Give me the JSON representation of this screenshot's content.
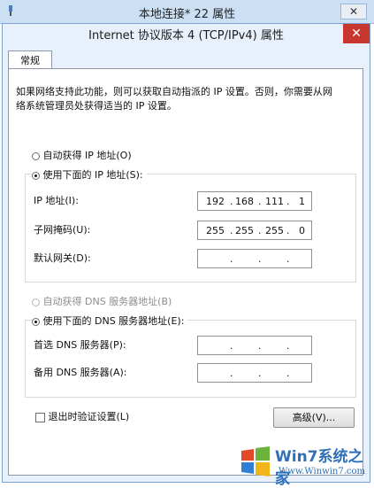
{
  "background_window": {
    "title": "本地连接* 22 属性",
    "close": "✕"
  },
  "dialog": {
    "title": "Internet 协议版本 4 (TCP/IPv4) 属性",
    "close": "✕",
    "tab": "常规",
    "description": [
      "如果网络支持此功能，则可以获取自动指派的 IP 设置。否则，你需要从网",
      "络系统管理员处获得适当的 IP 设置。"
    ],
    "ip": {
      "auto_label": "自动获得 IP 地址(O)",
      "manual_label": "使用下面的 IP 地址(S):",
      "selected": "manual",
      "fields": [
        {
          "label": "IP 地址(I):",
          "octets": [
            "192",
            "168",
            "111",
            "1"
          ]
        },
        {
          "label": "子网掩码(U):",
          "octets": [
            "255",
            "255",
            "255",
            "0"
          ]
        },
        {
          "label": "默认网关(D):",
          "octets": [
            "",
            "",
            "",
            ""
          ]
        }
      ]
    },
    "dns": {
      "auto_label": "自动获得 DNS 服务器地址(B)",
      "manual_label": "使用下面的 DNS 服务器地址(E):",
      "selected": "manual",
      "fields": [
        {
          "label": "首选 DNS 服务器(P):",
          "octets": [
            "",
            "",
            "",
            ""
          ]
        },
        {
          "label": "备用 DNS 服务器(A):",
          "octets": [
            "",
            "",
            "",
            ""
          ]
        }
      ]
    },
    "validate_on_exit": {
      "label": "退出时验证设置(L)",
      "checked": false
    },
    "advanced_button": "高级(V)..."
  },
  "watermark": {
    "brand": "Win7系统之家",
    "url": "Www.Winwin7.com"
  },
  "colors": {
    "title_bar": "#cbe0f5",
    "dialog_frame": "#e8f1fb",
    "close_red": "#c7372f"
  }
}
